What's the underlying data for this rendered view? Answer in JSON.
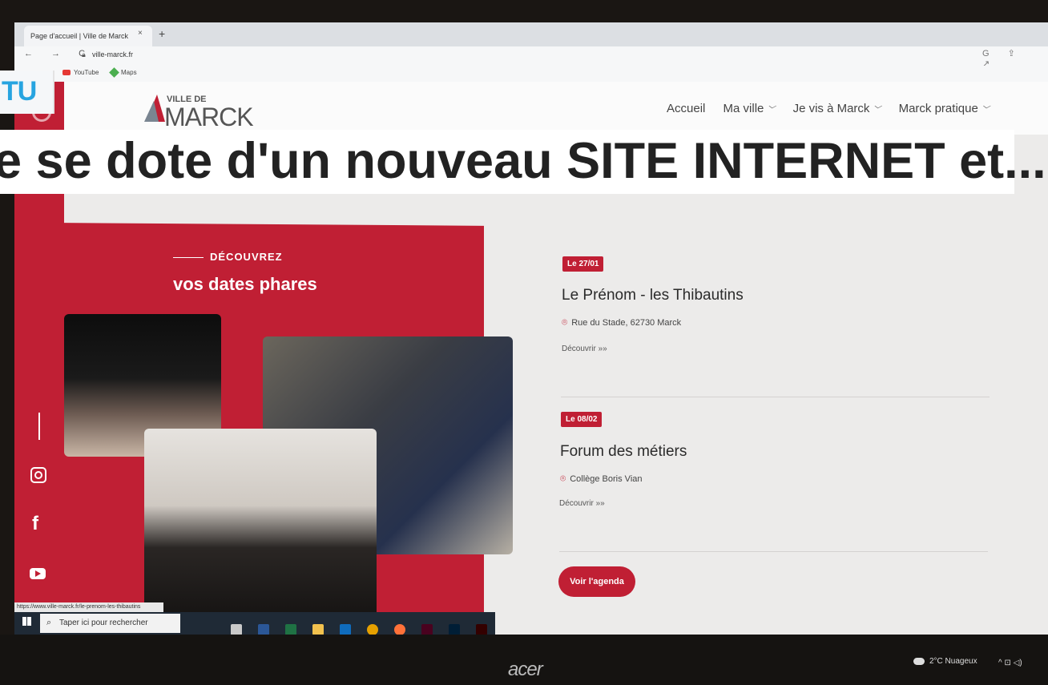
{
  "browser": {
    "tab_title": "Page d'accueil | Ville de Marck",
    "tab_close": "×",
    "new_tab": "+",
    "nav_icons": "← → C",
    "url": "ville-marck.fr",
    "right_icons": "G ⇪ ↗",
    "bookmarks": [
      "YouTube",
      "Maps"
    ],
    "status_url": "https://www.ville-marck.fr/le-prenom-les-thibautins"
  },
  "site": {
    "logo_small": "VILLE DE",
    "logo_big": "MARCK",
    "menu": [
      {
        "label": "Accueil",
        "has_dropdown": false
      },
      {
        "label": "Ma ville",
        "has_dropdown": true
      },
      {
        "label": "Je vis à Marck",
        "has_dropdown": true
      },
      {
        "label": "Marck pratique",
        "has_dropdown": true
      }
    ],
    "section_kicker": "DÉCOUVREZ",
    "section_title": "vos dates phares",
    "events": [
      {
        "date_prefix": "Le",
        "date": "27/01",
        "title": "Le Prénom - les Thibautins",
        "location": "Rue du Stade, 62730 Marck",
        "link": "Découvrir »»"
      },
      {
        "date_prefix": "Le",
        "date": "08/02",
        "title": "Forum des métiers",
        "location": "Collège Boris Vian",
        "link": "Découvrir »»"
      }
    ],
    "agenda_button": "Voir l'agenda",
    "social": [
      "instagram",
      "facebook",
      "youtube"
    ]
  },
  "taskbar": {
    "search_placeholder": "Taper ici pour rechercher",
    "apps": [
      "task-view",
      "word",
      "excel",
      "explorer",
      "outlook",
      "chrome",
      "firefox",
      "indesign",
      "photoshop",
      "illustrator"
    ],
    "weather": "2°C Nuageux",
    "tray": "^ ⊡ ◁)"
  },
  "monitor": {
    "brand": "acer"
  },
  "overlay": {
    "tag": "TU",
    "headline": "e se dote d'un nouveau SITE INTERNET et..."
  },
  "colors": {
    "brand_red": "#c01f34",
    "tag_blue": "#27a4e0"
  }
}
